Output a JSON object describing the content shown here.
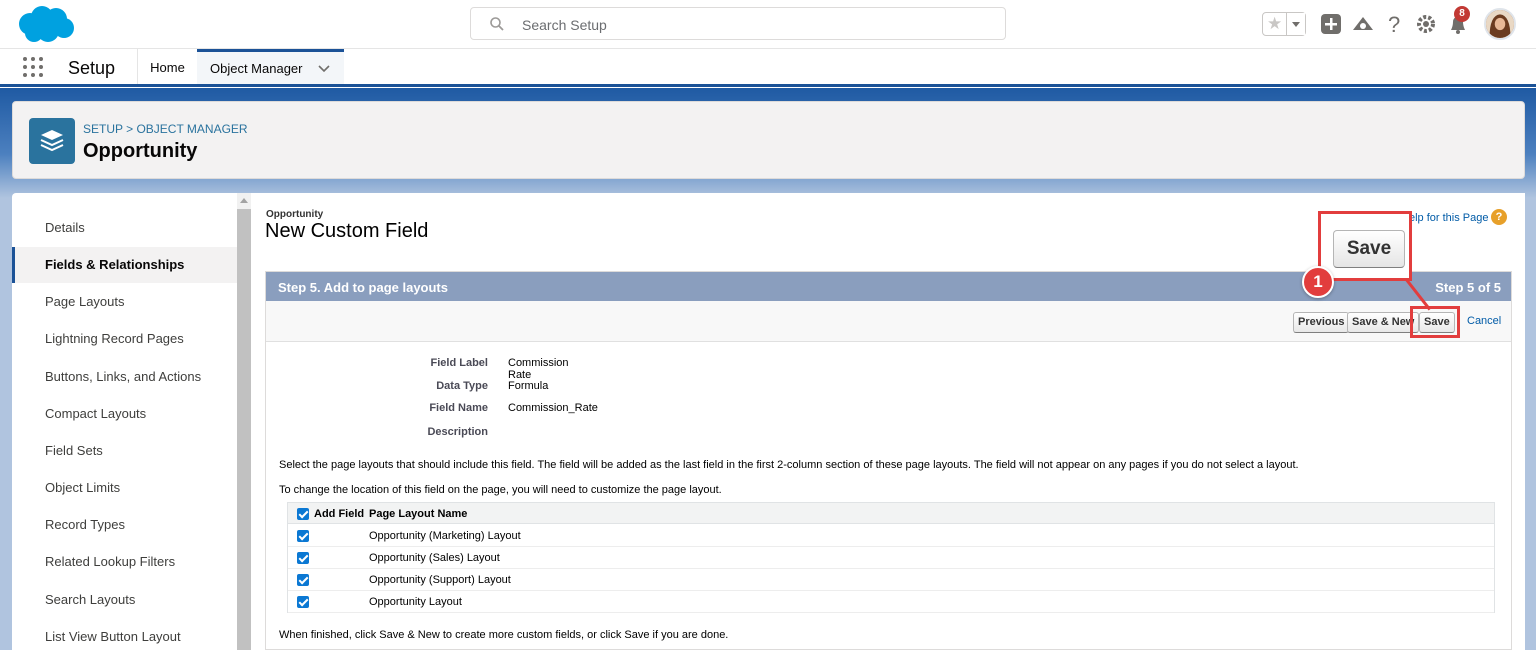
{
  "header": {
    "search_placeholder": "Search Setup",
    "notification_count": "8"
  },
  "nav": {
    "app_name": "Setup",
    "tabs": [
      {
        "label": "Home"
      },
      {
        "label": "Object Manager"
      }
    ]
  },
  "page_header": {
    "breadcrumb": "SETUP > OBJECT MANAGER",
    "title": "Opportunity"
  },
  "sidebar": {
    "items": [
      {
        "label": "Details"
      },
      {
        "label": "Fields & Relationships",
        "active": true
      },
      {
        "label": "Page Layouts"
      },
      {
        "label": "Lightning Record Pages"
      },
      {
        "label": "Buttons, Links, and Actions"
      },
      {
        "label": "Compact Layouts"
      },
      {
        "label": "Field Sets"
      },
      {
        "label": "Object Limits"
      },
      {
        "label": "Record Types"
      },
      {
        "label": "Related Lookup Filters"
      },
      {
        "label": "Search Layouts"
      },
      {
        "label": "List View Button Layout"
      }
    ]
  },
  "main": {
    "object_label": "Opportunity",
    "title": "New Custom Field",
    "help_link": "elp for this Page",
    "help_icon": "?",
    "step_title": "Step 5. Add to page layouts",
    "step_count": "Step 5 of 5",
    "buttons": {
      "previous": "Previous",
      "save_new": "Save & New",
      "save": "Save",
      "cancel": "Cancel"
    },
    "details": [
      {
        "label": "Field Label",
        "value": "Commission Rate"
      },
      {
        "label": "Data Type",
        "value": "Formula"
      },
      {
        "label": "Field Name",
        "value": "Commission_Rate"
      },
      {
        "label": "Description",
        "value": ""
      }
    ],
    "info_text_1": "Select the page layouts that should include this field. The field will be added as the last field in the first 2-column section of these page layouts. The field will not appear on any pages if you do not select a layout.",
    "info_text_2": "To change the location of this field on the page, you will need to customize the page layout.",
    "table": {
      "col_add": "Add Field",
      "col_name": "Page Layout Name",
      "rows": [
        {
          "name": "Opportunity (Marketing) Layout",
          "checked": true
        },
        {
          "name": "Opportunity (Sales) Layout",
          "checked": true
        },
        {
          "name": "Opportunity (Support) Layout",
          "checked": true
        },
        {
          "name": "Opportunity Layout",
          "checked": true
        }
      ]
    },
    "footer_text": "When finished, click Save & New to create more custom fields, or click Save if you are done."
  },
  "annotation": {
    "callout_label": "Save",
    "step_number": "1"
  },
  "colors": {
    "brand": "#1b5297",
    "highlight": "#e23d3d",
    "step_bar": "#8a9ebe",
    "object_icon": "#2a739e"
  }
}
